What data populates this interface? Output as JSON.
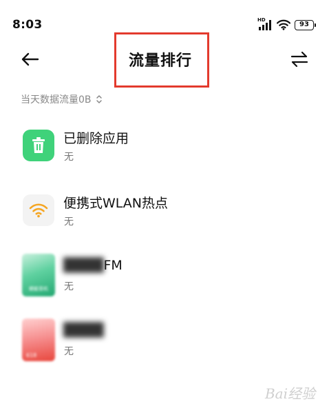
{
  "status_bar": {
    "time": "8:03",
    "network_label": "HD",
    "battery": "93"
  },
  "header": {
    "title": "流量排行"
  },
  "filter": {
    "label": "当天数据流量0B"
  },
  "apps": [
    {
      "name": "已删除应用",
      "usage": "无",
      "icon": "trash-icon",
      "color": "#3fd27a"
    },
    {
      "name": "便携式WLAN热点",
      "usage": "无",
      "icon": "wifi-hotspot-icon",
      "color": "#f5a623"
    },
    {
      "name": "FM",
      "usage": "无",
      "icon": "fm-radio-app-icon",
      "icon_text": "蜻蜓音机"
    },
    {
      "name": "",
      "usage": "无",
      "icon": "red-app-icon",
      "icon_text": "618"
    }
  ],
  "watermark": "Bai经验"
}
